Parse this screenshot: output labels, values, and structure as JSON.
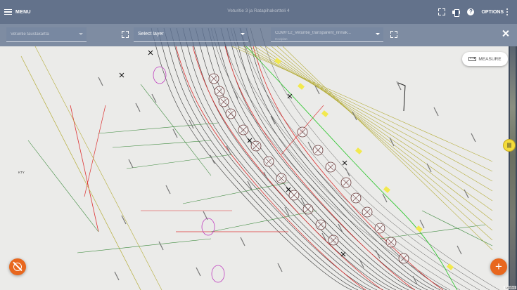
{
  "app": {
    "menu_label": "MENU",
    "title": "Veturitie 3 ja Ratapihakortteli 4",
    "options_label": "OPTIONS"
  },
  "icons": {
    "menu": "hamburger-icon",
    "fullscreen": "fullscreen-icon",
    "print": "printer-icon",
    "help": "help-icon",
    "options": "kebab-icon",
    "close": "close-icon",
    "measure": "ruler-icon",
    "locate": "location-off-icon",
    "add": "plus-icon",
    "swipe": "swipe-handle-icon"
  },
  "layers": {
    "base_layer": "Veturitie taustakartta",
    "middle_placeholder": "Select layer",
    "overlay_layer": "CDWF12_Veturitie_transparent_rinnak...",
    "overlay_sublabel": "Hoviplan"
  },
  "controls": {
    "measure_label": "MEASURE",
    "add_symbol": "+",
    "swipe_symbol": "|||"
  },
  "map": {
    "place_label": "KTY",
    "attribution": "Leaflet"
  },
  "colors": {
    "accent": "#e8671e",
    "topbar": "#465876",
    "swipe_handle": "#f4dc3a"
  }
}
